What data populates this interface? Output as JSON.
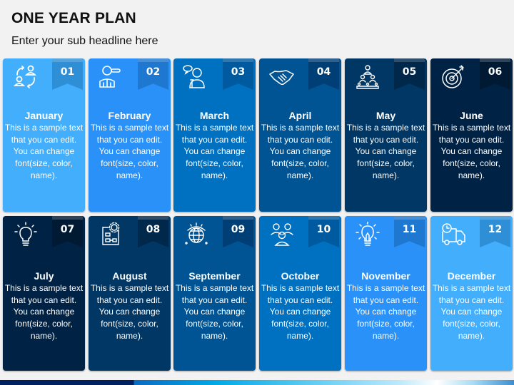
{
  "header": {
    "title": "ONE YEAR PLAN",
    "subtitle": "Enter your sub headline here"
  },
  "colors": {
    "shade1": "#42aefc",
    "shade2": "#2a91f8",
    "shade3": "#0070c0",
    "shade4": "#005493",
    "shade5": "#003764",
    "shade6": "#002244"
  },
  "months": [
    {
      "number": "01",
      "name": "January",
      "body": "This is a sample text that you can edit. You can change font(size, color, name).",
      "icon": "people-exchange-icon"
    },
    {
      "number": "02",
      "name": "February",
      "body": "This is a sample text that you can edit. You can change font(size, color, name).",
      "icon": "businessman-search-icon"
    },
    {
      "number": "03",
      "name": "March",
      "body": "This is a sample text that you can edit. You can change font(size, color, name).",
      "icon": "person-idea-speech-icon"
    },
    {
      "number": "04",
      "name": "April",
      "body": "This is a sample text that you can edit. You can change font(size, color, name).",
      "icon": "handshake-icon"
    },
    {
      "number": "05",
      "name": "May",
      "body": "This is a sample text that you can edit. You can change font(size, color, name).",
      "icon": "org-hierarchy-icon"
    },
    {
      "number": "06",
      "name": "June",
      "body": "This is a sample text that you can edit. You can change font(size, color, name).",
      "icon": "target-icon"
    },
    {
      "number": "07",
      "name": "July",
      "body": "This is a sample text that you can edit. You can change font(size, color, name).",
      "icon": "light-bulb-icon"
    },
    {
      "number": "08",
      "name": "August",
      "body": "This is a sample text that you can edit. You can change font(size, color, name).",
      "icon": "blueprint-gear-icon"
    },
    {
      "number": "09",
      "name": "September",
      "body": "This is a sample text that you can edit. You can change font(size, color, name).",
      "icon": "globe-network-icon"
    },
    {
      "number": "10",
      "name": "October",
      "body": "This is a sample text that you can edit. You can change font(size, color, name).",
      "icon": "team-group-icon"
    },
    {
      "number": "11",
      "name": "November",
      "body": "This is a sample text that you can edit. You can change font(size, color, name).",
      "icon": "light-bulb-icon"
    },
    {
      "number": "12",
      "name": "December",
      "body": "This is a sample text that you can edit. You can change font(size, color, name).",
      "icon": "delivery-truck-clock-icon"
    }
  ]
}
